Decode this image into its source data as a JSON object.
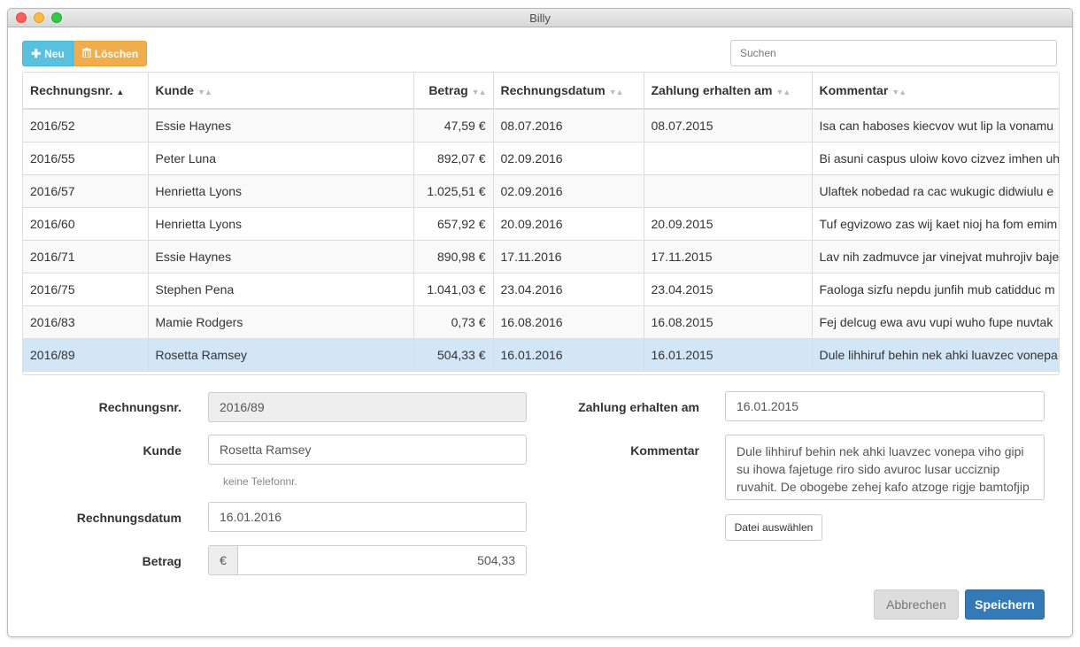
{
  "window": {
    "title": "Billy"
  },
  "toolbar": {
    "new_label": "Neu",
    "delete_label": "Löschen",
    "search_placeholder": "Suchen"
  },
  "table": {
    "columns": [
      "Rechnungsnr.",
      "Kunde",
      "Betrag",
      "Rechnungsdatum",
      "Zahlung erhalten am",
      "Kommentar"
    ],
    "sort_column": "Rechnungsnr.",
    "rows": [
      {
        "nr": "2016/52",
        "kunde": "Essie Haynes",
        "betrag": "47,59 €",
        "datum": "08.07.2016",
        "zahlung": "08.07.2015",
        "kommentar": "Isa can haboses kiecvov wut lip la vonamu"
      },
      {
        "nr": "2016/55",
        "kunde": "Peter Luna",
        "betrag": "892,07 €",
        "datum": "02.09.2016",
        "zahlung": "",
        "kommentar": "Bi asuni caspus uloiw kovo cizvez imhen uh"
      },
      {
        "nr": "2016/57",
        "kunde": "Henrietta Lyons",
        "betrag": "1.025,51 €",
        "datum": "02.09.2016",
        "zahlung": "",
        "kommentar": "Ulaftek nobedad ra cac wukugic didwiulu e"
      },
      {
        "nr": "2016/60",
        "kunde": "Henrietta Lyons",
        "betrag": "657,92 €",
        "datum": "20.09.2016",
        "zahlung": "20.09.2015",
        "kommentar": "Tuf egvizowo zas wij kaet nioj ha fom emim"
      },
      {
        "nr": "2016/71",
        "kunde": "Essie Haynes",
        "betrag": "890,98 €",
        "datum": "17.11.2016",
        "zahlung": "17.11.2015",
        "kommentar": "Lav nih zadmuvce jar vinejvat muhrojiv baje"
      },
      {
        "nr": "2016/75",
        "kunde": "Stephen Pena",
        "betrag": "1.041,03 €",
        "datum": "23.04.2016",
        "zahlung": "23.04.2015",
        "kommentar": "Faologa sizfu nepdu junfih mub catidduc m"
      },
      {
        "nr": "2016/83",
        "kunde": "Mamie Rodgers",
        "betrag": "0,73 €",
        "datum": "16.08.2016",
        "zahlung": "16.08.2015",
        "kommentar": "Fej delcug ewa avu vupi wuho fupe nuvtak"
      },
      {
        "nr": "2016/89",
        "kunde": "Rosetta Ramsey",
        "betrag": "504,33 €",
        "datum": "16.01.2016",
        "zahlung": "16.01.2015",
        "kommentar": "Dule lihhiruf behin nek ahki luavzec vonepa",
        "selected": true
      }
    ]
  },
  "form": {
    "nr_label": "Rechnungsnr.",
    "nr_value": "2016/89",
    "kunde_label": "Kunde",
    "kunde_value": "Rosetta Ramsey",
    "phone_hint": "keine Telefonnr.",
    "datum_label": "Rechnungsdatum",
    "datum_value": "16.01.2016",
    "betrag_label": "Betrag",
    "currency": "€",
    "betrag_value": "504,33",
    "zahlung_label": "Zahlung erhalten am",
    "zahlung_value": "16.01.2015",
    "kommentar_label": "Kommentar",
    "kommentar_value": "Dule lihhiruf behin nek ahki luavzec vonepa viho gipi su ihowa fajetuge riro sido avuroc lusar ucciznip ruvahit. De obogebe zehej kafo atzoge rigje bamtofjip lo lo liz wusi ukej bimzesu asrul ukedu",
    "file_button": "Datei auswählen",
    "cancel_button": "Abbrechen",
    "save_button": "Speichern"
  },
  "colors": {
    "info": "#5bc0de",
    "warning": "#f0ad4e",
    "primary": "#337ab7",
    "selected_row": "#d3e6f5"
  }
}
